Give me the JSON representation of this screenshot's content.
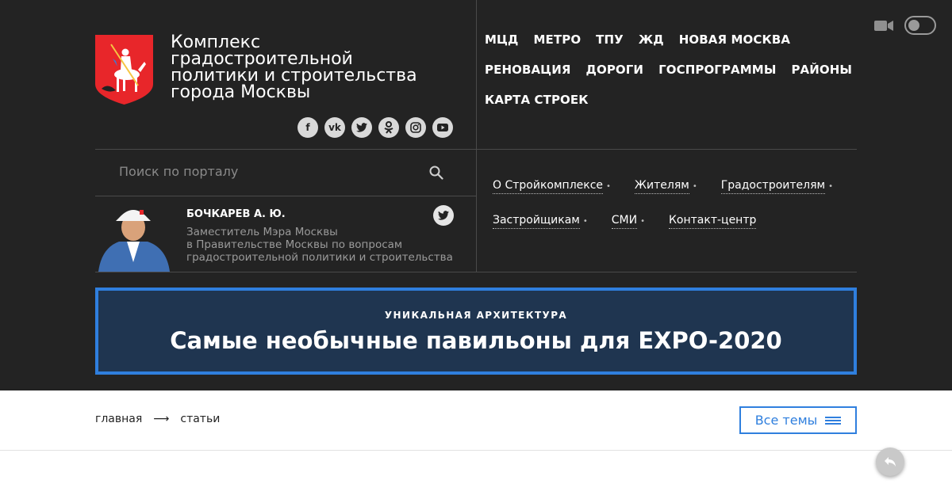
{
  "logo": {
    "title_lines": [
      "Комплекс",
      "градостроительной",
      "политики и строительства",
      "города Москвы"
    ]
  },
  "socials": [
    {
      "icon": "facebook-icon",
      "glyph": "f"
    },
    {
      "icon": "vk-icon",
      "glyph": "vk"
    },
    {
      "icon": "twitter-icon",
      "glyph": ""
    },
    {
      "icon": "odnoklassniki-icon",
      "glyph": ""
    },
    {
      "icon": "instagram-icon",
      "glyph": ""
    },
    {
      "icon": "youtube-icon",
      "glyph": ""
    }
  ],
  "main_nav": {
    "row1": [
      "МЦД",
      "МЕТРО",
      "ТПУ",
      "ЖД",
      "НОВАЯ МОСКВА"
    ],
    "row2": [
      "РЕНОВАЦИЯ",
      "ДОРОГИ",
      "ГОСПРОГРАММЫ",
      "РАЙОНЫ"
    ],
    "row3": [
      "КАРТА СТРОЕК"
    ]
  },
  "search": {
    "placeholder": "Поиск по порталу"
  },
  "person": {
    "name": "БОЧКАРЕВ А. Ю.",
    "role_lines": [
      "Заместитель Мэра Москвы",
      "в Правительстве Москвы по вопросам",
      "градостроительной политики и строительства"
    ]
  },
  "sub_nav": {
    "row1": [
      {
        "label": "О Стройкомплексе",
        "has_dropdown": true
      },
      {
        "label": "Жителям",
        "has_dropdown": true
      },
      {
        "label": "Градостроителям",
        "has_dropdown": true
      }
    ],
    "row2": [
      {
        "label": "Застройщикам",
        "has_dropdown": true
      },
      {
        "label": "СМИ",
        "has_dropdown": true
      },
      {
        "label": "Контакт-центр",
        "has_dropdown": false
      }
    ]
  },
  "banner": {
    "kicker": "УНИКАЛЬНАЯ АРХИТЕКТУРА",
    "title": "Самые необычные павильоны для EXPO-2020"
  },
  "breadcrumb": {
    "home": "главная",
    "arrow": "⟶",
    "current": "статьи"
  },
  "all_topics_label": "Все темы",
  "colors": {
    "header_bg": "#232323",
    "accent_blue": "#2f7fde",
    "banner_bg": "#1f3550"
  }
}
